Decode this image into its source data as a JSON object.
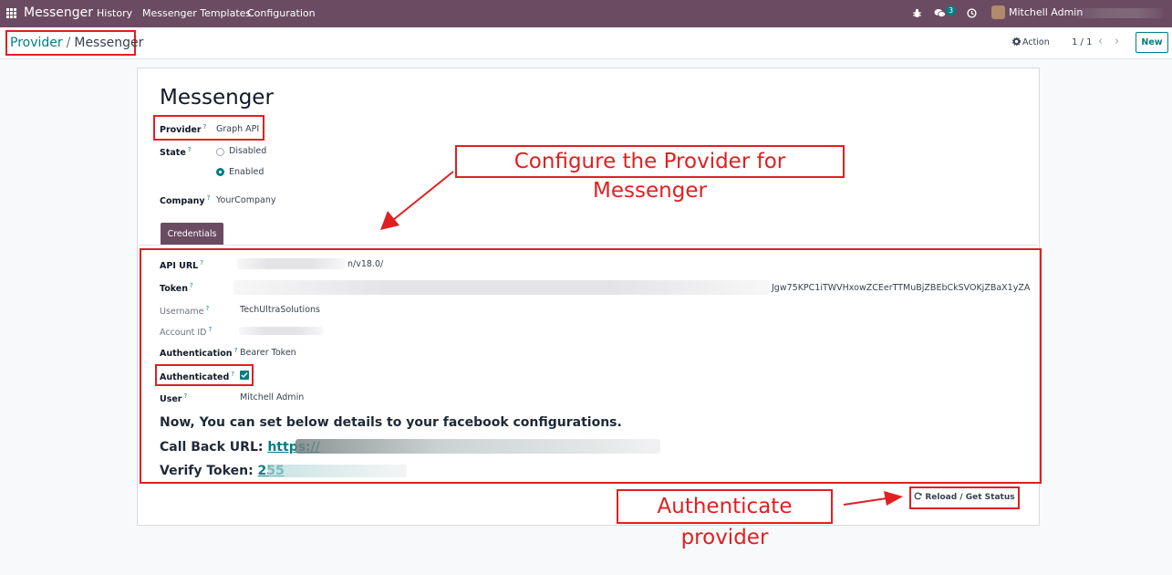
{
  "navbar": {
    "brand": "Messenger",
    "menu": [
      "History",
      "Messenger Templates",
      "Configuration"
    ],
    "message_count": "3",
    "user": "Mitchell Admin",
    "icons": [
      "apps-grid-icon",
      "bug-icon",
      "chat-icon",
      "clock-icon"
    ]
  },
  "breadcrumb": {
    "parent": "Provider",
    "separator": "/",
    "current": "Messenger"
  },
  "control": {
    "action_label": "Action",
    "pager": "1 / 1",
    "new_label": "New"
  },
  "form": {
    "title": "Messenger",
    "provider_label": "Provider",
    "provider_value": "Graph API",
    "state_label": "State",
    "state_options": [
      "Disabled",
      "Enabled"
    ],
    "state_selected": "Enabled",
    "company_label": "Company",
    "company_value": "YourCompany",
    "tab_label": "Credentials",
    "help_mark": "?"
  },
  "credentials": {
    "api_url_label": "API URL",
    "api_url_value": "n/v18.0/",
    "token_label": "Token",
    "token_value": "Jgw75KPC1iTWVHxowZCEerTTMuBjZBEbCkSVOKjZBaX1yZA",
    "username_label": "Username",
    "username_value": "TechUltraSolutions",
    "account_id_label": "Account ID",
    "authentication_label": "Authentication",
    "authentication_value": "Bearer Token",
    "authenticated_label": "Authenticated",
    "authenticated": true,
    "user_label": "User",
    "user_value": "Mitchell Admin"
  },
  "facebook": {
    "heading": "Now, You can set below details to your facebook configurations.",
    "callback_label": "Call Back URL:",
    "callback_value": "https://",
    "verify_label": "Verify Token:",
    "verify_value": "255"
  },
  "annotations": {
    "configure_callout": "Configure the Provider for Messenger",
    "authenticate_callout": "Authenticate provider",
    "color": "#e02020"
  },
  "reload_button": "Reload / Get Status",
  "colors": {
    "navbar": "#6b4b62",
    "accent": "#017e84",
    "annotation": "#e02020"
  }
}
